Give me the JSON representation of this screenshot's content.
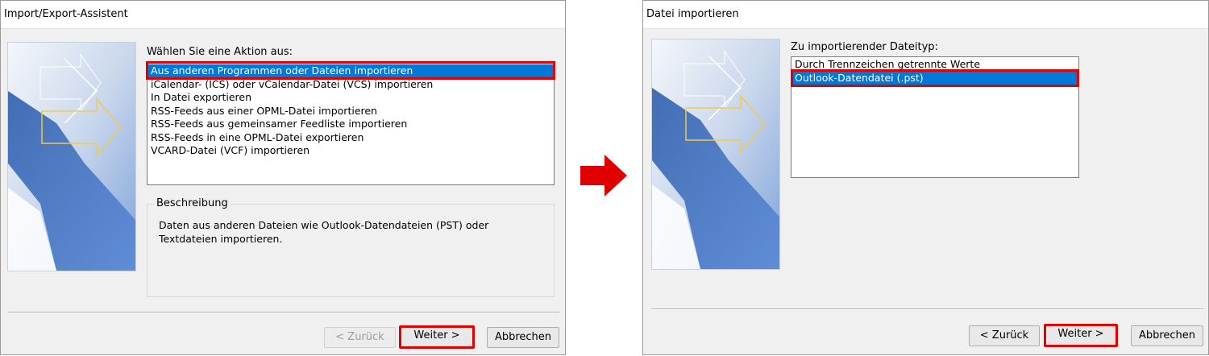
{
  "colors": {
    "selection": "#0078d7",
    "highlight_frame": "#e00000",
    "arrow": "#e00000"
  },
  "left_dialog": {
    "title": "Import/Export-Assistent",
    "prompt": "Wählen Sie eine Aktion aus:",
    "actions": [
      "Aus anderen Programmen oder Dateien importieren",
      "iCalendar- (ICS) oder vCalendar-Datei (VCS) importieren",
      "In Datei exportieren",
      "RSS-Feeds aus einer OPML-Datei importieren",
      "RSS-Feeds aus gemeinsamer Feedliste importieren",
      "RSS-Feeds in eine OPML-Datei exportieren",
      "VCARD-Datei (VCF) importieren"
    ],
    "selected_index": 0,
    "description_title": "Beschreibung",
    "description_text": "Daten aus anderen Dateien wie Outlook-Datendateien (PST) oder Textdateien importieren.",
    "buttons": {
      "back": "< Zurück",
      "next": "Weiter >",
      "cancel": "Abbrechen"
    },
    "back_enabled": false
  },
  "flow_arrow_icon": "right-arrow-icon",
  "right_dialog": {
    "title": "Datei importieren",
    "prompt": "Zu importierender Dateityp:",
    "file_types": [
      "Durch Trennzeichen getrennte Werte",
      "Outlook-Datendatei (.pst)"
    ],
    "selected_index": 1,
    "buttons": {
      "back": "< Zurück",
      "next": "Weiter >",
      "cancel": "Abbrechen"
    },
    "back_enabled": true
  }
}
